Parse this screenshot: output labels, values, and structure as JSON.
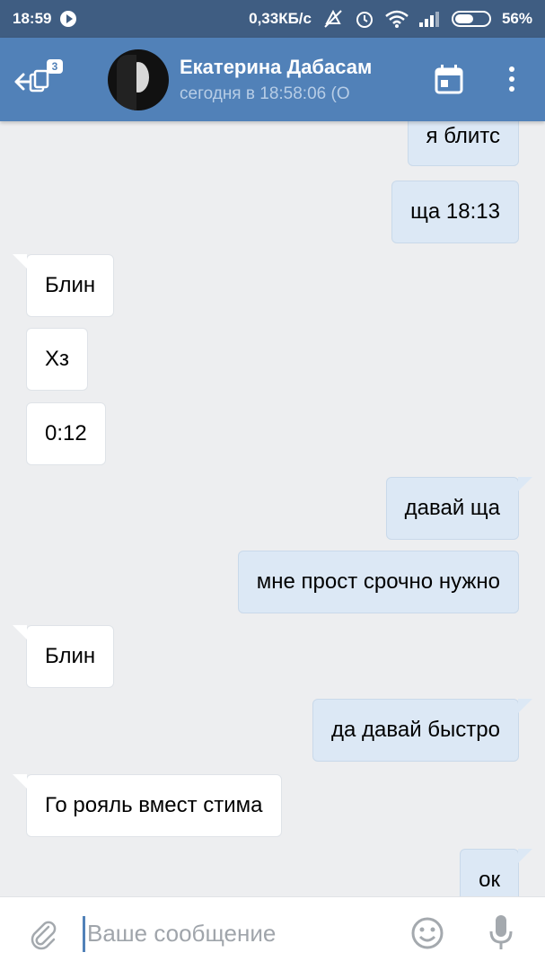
{
  "status_bar": {
    "time": "18:59",
    "speed": "0,33КБ/с",
    "battery_percent": "56%",
    "battery_level": 0.56
  },
  "header": {
    "back_badge": "3",
    "contact_name": "Екатерина Дабасам",
    "contact_status": "сегодня в 18:58:06 (О",
    "accent_color": "#5181b8"
  },
  "messages": [
    {
      "side": "out",
      "text": "я блитс",
      "tail": false
    },
    {
      "side": "out",
      "text": "ща 18:13",
      "tail": false
    },
    {
      "side": "in",
      "text": "Блин",
      "tail": true
    },
    {
      "side": "in",
      "text": "Хз",
      "tail": false
    },
    {
      "side": "in",
      "text": "0:12",
      "tail": false
    },
    {
      "side": "out",
      "text": "давай ща",
      "tail": true
    },
    {
      "side": "out",
      "text": "мне прост срочно нужно",
      "tail": false
    },
    {
      "side": "in",
      "text": "Блин",
      "tail": true
    },
    {
      "side": "out",
      "text": "да давай быстро",
      "tail": true
    },
    {
      "side": "in",
      "text": "Го рояль вмест стима",
      "tail": true
    },
    {
      "side": "out",
      "text": "ок",
      "tail": true
    }
  ],
  "composer": {
    "placeholder": "Ваше сообщение",
    "value": ""
  },
  "icons": {
    "attach": "paperclip-icon",
    "emoji": "smiley-icon",
    "mic": "microphone-icon",
    "calendar": "calendar-icon",
    "menu": "more-vertical-icon"
  }
}
